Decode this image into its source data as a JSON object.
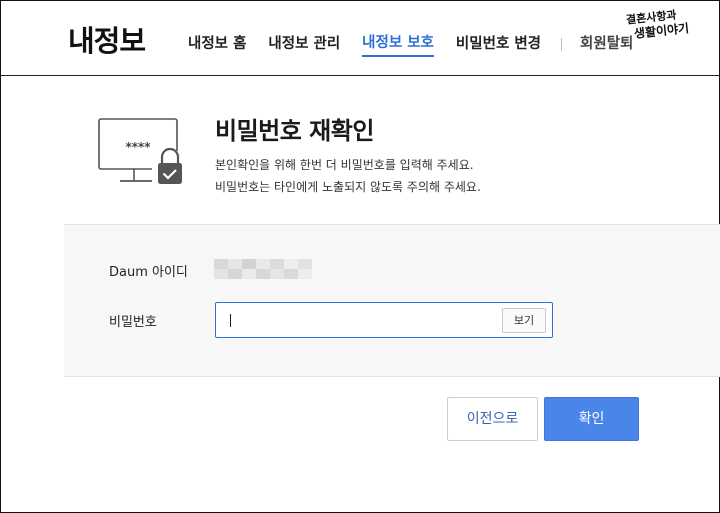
{
  "header": {
    "brand": "내정보",
    "nav": [
      {
        "label": "내정보 홈"
      },
      {
        "label": "내정보 관리"
      },
      {
        "label": "내정보 보호"
      },
      {
        "label": "비밀번호 변경"
      },
      {
        "label": "회원탈퇴"
      }
    ],
    "watermark": {
      "line1": "결혼사항과",
      "line2": "생활이야기"
    }
  },
  "intro": {
    "icon_text": "****",
    "title": "비밀번호 재확인",
    "desc_line1": "본인확인을 위해 한번 더 비밀번호를 입력해 주세요.",
    "desc_line2": "비밀번호는 타인에게 노출되지 않도록 주의해 주세요."
  },
  "form": {
    "id_label": "Daum 아이디",
    "password_label": "비밀번호",
    "password_value": "",
    "show_label": "보기"
  },
  "actions": {
    "prev_label": "이전으로",
    "confirm_label": "확인"
  },
  "colors": {
    "accent": "#2f6fd6",
    "primary_button": "#4a86ea"
  }
}
